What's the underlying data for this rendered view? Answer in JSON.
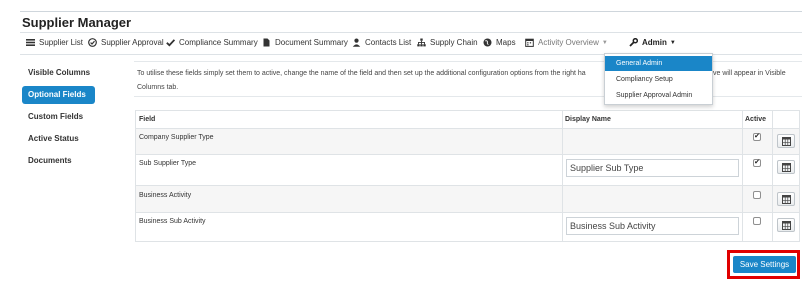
{
  "app": {
    "title": "Supplier Manager"
  },
  "nav": {
    "items": [
      {
        "label": "Supplier List",
        "icon": "list-icon"
      },
      {
        "label": "Supplier Approval",
        "icon": "check-circle-icon"
      },
      {
        "label": "Compliance Summary",
        "icon": "checkmark-icon"
      },
      {
        "label": "Document Summary",
        "icon": "document-icon"
      },
      {
        "label": "Contacts List",
        "icon": "user-icon"
      },
      {
        "label": "Supply Chain",
        "icon": "sitemap-icon"
      },
      {
        "label": "Maps",
        "icon": "globe-icon"
      },
      {
        "label": "Activity Overview",
        "icon": "calendar-icon"
      },
      {
        "label": "Admin",
        "icon": "wrench-icon"
      }
    ]
  },
  "admin_menu": {
    "items": [
      "General Admin",
      "Compliancy Setup",
      "Supplier Approval Admin"
    ],
    "active": "General Admin"
  },
  "sidebar": {
    "items": [
      "Visible Columns",
      "Optional Fields",
      "Custom Fields",
      "Active Status",
      "Documents"
    ],
    "active": "Optional Fields"
  },
  "info": {
    "line1": "To utilise these fields simply set them to active, change the name of the field and then set up the additional configuration options from the right ha",
    "line1_end": "ve will appear in Visible",
    "line2": "Columns tab."
  },
  "table": {
    "headers": {
      "field": "Field",
      "display_name": "Display Name",
      "active": "Active"
    },
    "rows": [
      {
        "field": "Company Supplier Type",
        "display_name": "",
        "active": true
      },
      {
        "field": "Sub Supplier Type",
        "display_name": "Supplier Sub Type",
        "active": true
      },
      {
        "field": "Business Activity",
        "display_name": "",
        "active": false
      },
      {
        "field": "Business Sub Activity",
        "display_name": "Business Sub Activity",
        "active": false
      }
    ]
  },
  "actions": {
    "save_label": "Save Settings"
  },
  "colors": {
    "accent": "#1a86c8",
    "highlight": "#e00000"
  }
}
